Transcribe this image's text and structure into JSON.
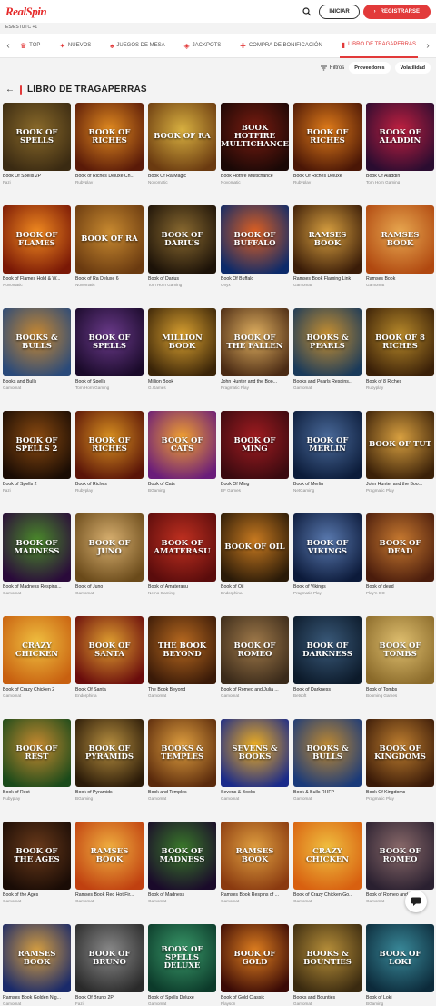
{
  "header": {
    "logo_text": "RealSpin",
    "login_label": "INICIAR",
    "register_label": "REGISTRARSE",
    "register_icon": "›",
    "search_icon": "search-icon"
  },
  "locale_label": "ES/ESTUTC +1",
  "nav": {
    "prev_icon": "‹",
    "next_icon": "›",
    "items": [
      {
        "label": "TOP",
        "icon": "♛"
      },
      {
        "label": "NUEVOS",
        "icon": "✦"
      },
      {
        "label": "JUEGOS DE MESA",
        "icon": "♠"
      },
      {
        "label": "JACKPOTS",
        "icon": "◈"
      },
      {
        "label": "COMPRA DE BONIFICACIÓN",
        "icon": "✚"
      },
      {
        "label": "LIBRO DE TRAGAPERRAS",
        "icon": "▮"
      }
    ]
  },
  "filters": {
    "filter_label": "Filtros",
    "providers_label": "Proveedores",
    "volatility_label": "Volatilidad"
  },
  "section": {
    "back_icon": "←",
    "title": "LIBRO DE TRAGAPERRAS"
  },
  "games": [
    {
      "name": "Book Of Spells 2P",
      "provider": "Fazi",
      "art": "Book of Spells",
      "c1": "#3a2a12",
      "c2": "#8a6a2a"
    },
    {
      "name": "Book of Riches Deluxe Ch...",
      "provider": "Rubyplay",
      "art": "Book of Riches",
      "c1": "#5a1a08",
      "c2": "#e08a20"
    },
    {
      "name": "Book Of Ra Magic",
      "provider": "Novomatic",
      "art": "Book of Ra",
      "c1": "#6a3a10",
      "c2": "#d8b040"
    },
    {
      "name": "Book Hotfire Multichance",
      "provider": "Novomatic",
      "art": "Book Hotfire Multichance",
      "c1": "#1a0806",
      "c2": "#7a1c10"
    },
    {
      "name": "Book Of Riches Deluxe",
      "provider": "Rubyplay",
      "art": "Book of Riches",
      "c1": "#4a1606",
      "c2": "#e07c1a"
    },
    {
      "name": "Book Of Aladdin",
      "provider": "Tom Horn Gaming",
      "art": "Book of Aladdin",
      "c1": "#2a0c30",
      "c2": "#c02040"
    },
    {
      "name": "Book of Flames Hold & W...",
      "provider": "Novomatic",
      "art": "Book of Flames",
      "c1": "#7a1806",
      "c2": "#f08a20"
    },
    {
      "name": "Book of Ra Deluxe 6",
      "provider": "Novomatic",
      "art": "Book of Ra",
      "c1": "#6a3a10",
      "c2": "#c88a30"
    },
    {
      "name": "Book of Darius",
      "provider": "Tom Horn Gaming",
      "art": "Book of Darius",
      "c1": "#1c1208",
      "c2": "#8a6a30"
    },
    {
      "name": "Book Of Buffalo",
      "provider": "Onyx",
      "art": "Book of Buffalo",
      "c1": "#0c2a6a",
      "c2": "#e06020"
    },
    {
      "name": "Ramses Book Flaming Link",
      "provider": "Gamomat",
      "art": "Ramses Book",
      "c1": "#3a1c08",
      "c2": "#d8a040"
    },
    {
      "name": "Ramses Book",
      "provider": "Gamomat",
      "art": "Ramses Book",
      "c1": "#b04810",
      "c2": "#e8a850"
    },
    {
      "name": "Books and Bulls",
      "provider": "Gamomat",
      "art": "Books & Bulls",
      "c1": "#2a4a7a",
      "c2": "#c88830"
    },
    {
      "name": "Book of Spells",
      "provider": "Tom Horn Gaming",
      "art": "Book of Spells",
      "c1": "#1a0a2a",
      "c2": "#6a3a8a"
    },
    {
      "name": "Million Book",
      "provider": "G.Games",
      "art": "Million Book",
      "c1": "#3a2408",
      "c2": "#d8a030"
    },
    {
      "name": "John Hunter and the Boo...",
      "provider": "Pragmatic Play",
      "art": "Book of the Fallen",
      "c1": "#4a2a14",
      "c2": "#e0b060"
    },
    {
      "name": "Books and Pearls Respins...",
      "provider": "Gamomat",
      "art": "Books & Pearls",
      "c1": "#1a3a5a",
      "c2": "#c89030"
    },
    {
      "name": "Book of 8 Riches",
      "provider": "Rubyplay",
      "art": "Book of 8 Riches",
      "c1": "#3a2008",
      "c2": "#b88a2a"
    },
    {
      "name": "Book of Spells 2",
      "provider": "Fazi",
      "art": "Book of Spells 2",
      "c1": "#1a0c04",
      "c2": "#8a4a10"
    },
    {
      "name": "Book of Riches",
      "provider": "Rubyplay",
      "art": "Book of Riches",
      "c1": "#5a1408",
      "c2": "#d89020"
    },
    {
      "name": "Book of Cats",
      "provider": "BGaming",
      "art": "Book of Cats",
      "c1": "#6a1c7a",
      "c2": "#f0a030"
    },
    {
      "name": "Book Of Ming",
      "provider": "BF Games",
      "art": "Book of Ming",
      "c1": "#3a0a10",
      "c2": "#a01c20"
    },
    {
      "name": "Book of Merlin",
      "provider": "NetGaming",
      "art": "Book of Merlin",
      "c1": "#0c1c3a",
      "c2": "#4a6a9a"
    },
    {
      "name": "John Hunter and the Boo...",
      "provider": "Pragmatic Play",
      "art": "Book of Tut",
      "c1": "#3a2008",
      "c2": "#d8a040"
    },
    {
      "name": "Book of Madness Respins...",
      "provider": "Gamomat",
      "art": "Book of Madness",
      "c1": "#2a0a3a",
      "c2": "#4a8a2a"
    },
    {
      "name": "Book of Juno",
      "provider": "Gamomat",
      "art": "Book of Juno",
      "c1": "#6a4a1a",
      "c2": "#d8b070"
    },
    {
      "name": "Book of Amaterasu",
      "provider": "Nemo Gaming",
      "art": "Book of Amaterasu",
      "c1": "#5a0c0c",
      "c2": "#c03020"
    },
    {
      "name": "Book of Oil",
      "provider": "Endorphina",
      "art": "Book of Oil",
      "c1": "#2a1a08",
      "c2": "#c87a20"
    },
    {
      "name": "Book of Vikings",
      "provider": "Pragmatic Play",
      "art": "Book of Vikings",
      "c1": "#0c1a3a",
      "c2": "#5a7ab0"
    },
    {
      "name": "Book of dead",
      "provider": "Play'n GO",
      "art": "Book of Dead",
      "c1": "#4a1c0c",
      "c2": "#c87a30"
    },
    {
      "name": "Book of Crazy Chicken 2",
      "provider": "Gamomat",
      "art": "Crazy Chicken",
      "c1": "#c86010",
      "c2": "#f0c040"
    },
    {
      "name": "Book Of Santa",
      "provider": "Endorphina",
      "art": "Book of Santa",
      "c1": "#6a0c0c",
      "c2": "#e0a030"
    },
    {
      "name": "The Book Beyond",
      "provider": "Gamomat",
      "art": "The Book Beyond",
      "c1": "#3a1a08",
      "c2": "#b86a20"
    },
    {
      "name": "Book of Romeo and Julia ...",
      "provider": "Gamomat",
      "art": "Book of Romeo",
      "c1": "#3a2a1a",
      "c2": "#a07a4a"
    },
    {
      "name": "Book of Darkness",
      "provider": "Betsoft",
      "art": "Book of Darkness",
      "c1": "#0c1a2a",
      "c2": "#3a5a7a"
    },
    {
      "name": "Book of Tombs",
      "provider": "Booming Games",
      "art": "Book of Tombs",
      "c1": "#8a6a2a",
      "c2": "#e0c070"
    },
    {
      "name": "Book of Rest",
      "provider": "Rubyplay",
      "art": "Book of Rest",
      "c1": "#1a4a1a",
      "c2": "#c88a30"
    },
    {
      "name": "Book of Pyramids",
      "provider": "BGaming",
      "art": "Book of Pyramids",
      "c1": "#2a1a08",
      "c2": "#b89040"
    },
    {
      "name": "Book and Temples",
      "provider": "Gamomat",
      "art": "Books & Temples",
      "c1": "#5a2a0c",
      "c2": "#e0a040"
    },
    {
      "name": "Sevens & Books",
      "provider": "Gamomat",
      "art": "Sevens & Books",
      "c1": "#1a2a8a",
      "c2": "#f0b020"
    },
    {
      "name": "Book & Bulls RHFP",
      "provider": "Gamomat",
      "art": "Books & Bulls",
      "c1": "#1a3a7a",
      "c2": "#c08a30"
    },
    {
      "name": "Book Of Kingdoms",
      "provider": "Pragmatic Play",
      "art": "Book of Kingdoms",
      "c1": "#3a1a08",
      "c2": "#c08030"
    },
    {
      "name": "Book of the Ages",
      "provider": "Gamomat",
      "art": "Book of the Ages",
      "c1": "#1a0c06",
      "c2": "#6a3a1a"
    },
    {
      "name": "Ramses Book Red Hot Fir...",
      "provider": "Gamomat",
      "art": "Ramses Book",
      "c1": "#c04010",
      "c2": "#f0b040"
    },
    {
      "name": "Book of Madness",
      "provider": "Gamomat",
      "art": "Book of Madness",
      "c1": "#1a0a2a",
      "c2": "#3a7a2a"
    },
    {
      "name": "Ramses Book Respins of ...",
      "provider": "Gamomat",
      "art": "Ramses Book",
      "c1": "#8a3a10",
      "c2": "#e0a040"
    },
    {
      "name": "Book of Crazy Chicken Go...",
      "provider": "Gamomat",
      "art": "Crazy Chicken",
      "c1": "#d86010",
      "c2": "#f0c040"
    },
    {
      "name": "Book of Romeo and Julia",
      "provider": "Gamomat",
      "art": "Book of Romeo",
      "c1": "#2a2030",
      "c2": "#8a6a6a"
    },
    {
      "name": "Ramses Book Golden Nig...",
      "provider": "Gamomat",
      "art": "Ramses Book",
      "c1": "#1a2a6a",
      "c2": "#d8a040"
    },
    {
      "name": "Book Of Bruno 2P",
      "provider": "Fazi",
      "art": "Book of Bruno",
      "c1": "#2a2a2a",
      "c2": "#8a8a8a"
    },
    {
      "name": "Book of Spells Deluxe",
      "provider": "Gamomat",
      "art": "Book of Spells Deluxe",
      "c1": "#0c3a2a",
      "c2": "#3a9a6a"
    },
    {
      "name": "Book of Gold Classic",
      "provider": "Playson",
      "art": "Book of Gold",
      "c1": "#3a0a06",
      "c2": "#e08020"
    },
    {
      "name": "Books and Bounties",
      "provider": "Gamomat",
      "art": "Books & Bounties",
      "c1": "#3a2a10",
      "c2": "#b8903a"
    },
    {
      "name": "Book of Loki",
      "provider": "BGaming",
      "art": "Book of Loki",
      "c1": "#0c2a3a",
      "c2": "#3a8a9a"
    }
  ]
}
